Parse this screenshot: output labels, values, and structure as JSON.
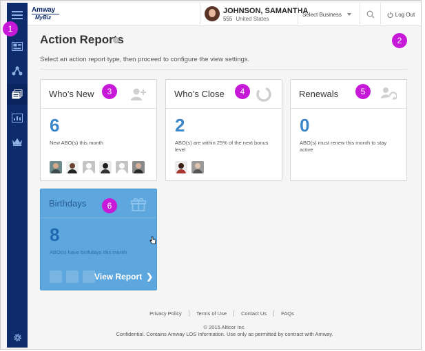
{
  "brand": {
    "logo_top": "Amway",
    "logo_bottom": "MyBiz"
  },
  "header": {
    "user_name": "JOHNSON, SAMANTHA",
    "user_id": "555",
    "user_country": "United States",
    "select_business": "Select Business",
    "logout_label": "Log Out"
  },
  "page": {
    "title": "Action Reports",
    "info_glyph": "i",
    "subtitle": "Select an action report type, then proceed to configure the view settings."
  },
  "cards": {
    "whos_new": {
      "title": "Who’s New",
      "count": "6",
      "desc": "New ABO(s) this month",
      "avatars": 6
    },
    "whos_close": {
      "title": "Who’s Close",
      "count": "2",
      "desc": "ABO(s) are within 25% of the next bonus level",
      "avatars": 2
    },
    "renewals": {
      "title": "Renewals",
      "count": "0",
      "desc": "ABO(s) must renew this month to stay active"
    },
    "birthdays": {
      "title": "Birthdays",
      "count": "8",
      "desc": "ABO(s) have birthdays this month",
      "action": "View Report"
    }
  },
  "callouts": [
    "1",
    "2",
    "3",
    "4",
    "5",
    "6"
  ],
  "footer": {
    "links": [
      "Privacy Policy",
      "Terms of Use",
      "Contact Us",
      "FAQs"
    ],
    "copyright": "© 2015 Alticor Inc.",
    "confidential": "Confidential. Contains Amway LOS Information. Use only as permitted by contract with Amway."
  },
  "icons": {
    "rail": [
      "menu-icon",
      "dashboard-icon",
      "network-icon",
      "reports-icon",
      "chart-icon",
      "crown-icon",
      "gear-icon"
    ],
    "header": [
      "search-icon",
      "power-icon"
    ],
    "cards": [
      "add-person-icon",
      "progress-ring-icon",
      "renew-person-icon",
      "gift-icon"
    ]
  },
  "colors": {
    "rail": "#0e2b6b",
    "accent": "#3b86c8",
    "birthday_card": "#5ea7de",
    "callout": "#c61ad8"
  }
}
